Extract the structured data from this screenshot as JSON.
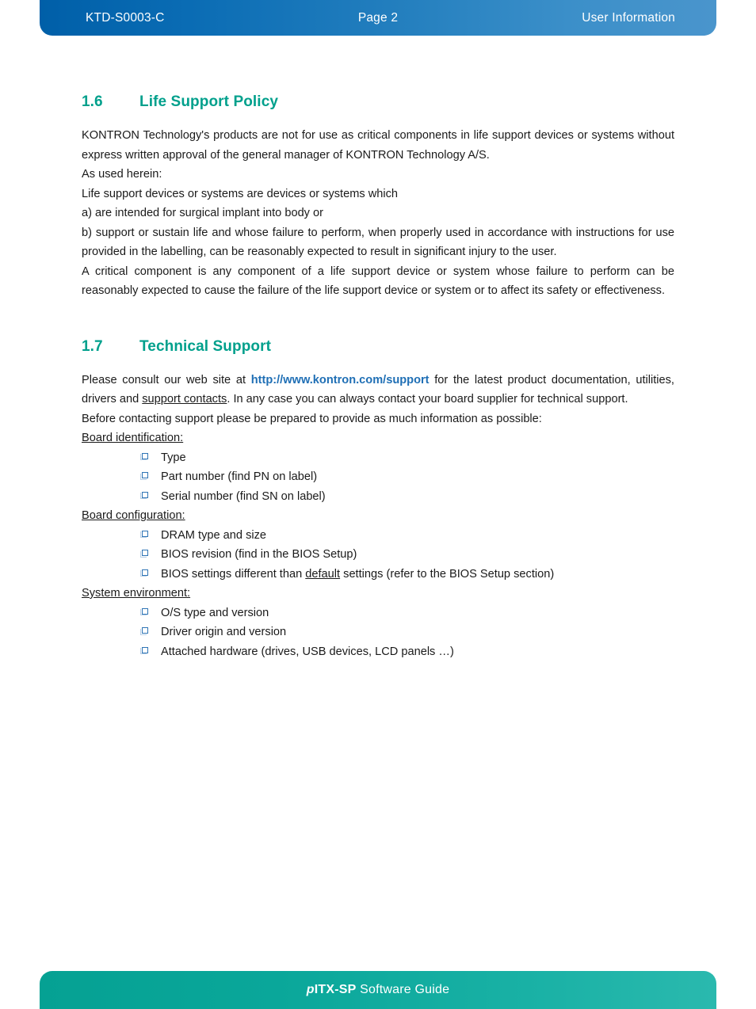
{
  "header": {
    "doc_id": "KTD-S0003-C",
    "page": "Page 2",
    "section": "User Information",
    "bg_color_left": "#005fa8",
    "bg_color_right": "#4a95cc"
  },
  "footer": {
    "product_prefix": "p",
    "product_name": "ITX-SP",
    "guide_label": "Software Guide",
    "bg_color": "#0aa79a"
  },
  "accent": {
    "heading_color": "#00a08c",
    "link_color": "#1f6fb5",
    "bullet_color": "#2e74b5"
  },
  "sections": [
    {
      "number": "1.6",
      "title": "Life Support Policy",
      "paragraphs": [
        "KONTRON Technology's products are not for use as critical components in life support devices or systems without express written approval of the general manager of KONTRON Technology A/S.",
        "As used herein:",
        "Life support devices or systems are devices or systems which",
        "a) are intended for surgical implant into body or",
        "b) support or sustain life and whose failure to perform, when properly used in accordance with instructions for use provided in the labelling, can be reasonably expected to result in significant injury to the user.",
        "A critical component is any component of a life support device or system whose failure to perform can be reasonably expected to cause the failure of the life support device or system or to affect its safety or effectiveness."
      ]
    },
    {
      "number": "1.7",
      "title": "Technical Support",
      "intro": {
        "before_link": "Please consult our web site at ",
        "link_text": "http://www.kontron.com/support",
        "after_link": " for the latest product documentation, utilities, drivers and ",
        "underlined_text": "support contacts",
        "tail": ". In any case you can always contact your board supplier for technical support."
      },
      "prepare_line": "Before contacting support please be prepared to provide as much information as possible:",
      "groups": [
        {
          "label": "Board identification:",
          "items": [
            {
              "text": "Type"
            },
            {
              "text": "Part number (find PN on label)"
            },
            {
              "text": "Serial number (find SN on label)"
            }
          ]
        },
        {
          "label": "Board configuration:",
          "items": [
            {
              "text": "DRAM type and size"
            },
            {
              "text": "BIOS revision (find in the BIOS Setup)"
            },
            {
              "text_before": "BIOS settings different than ",
              "underlined": "default",
              "text_after": " settings (refer to the BIOS Setup section)"
            }
          ]
        },
        {
          "label": "System environment:",
          "items": [
            {
              "text": "O/S type and version"
            },
            {
              "text": "Driver origin and version"
            },
            {
              "text": "Attached hardware (drives, USB devices, LCD panels …)"
            }
          ]
        }
      ]
    }
  ]
}
